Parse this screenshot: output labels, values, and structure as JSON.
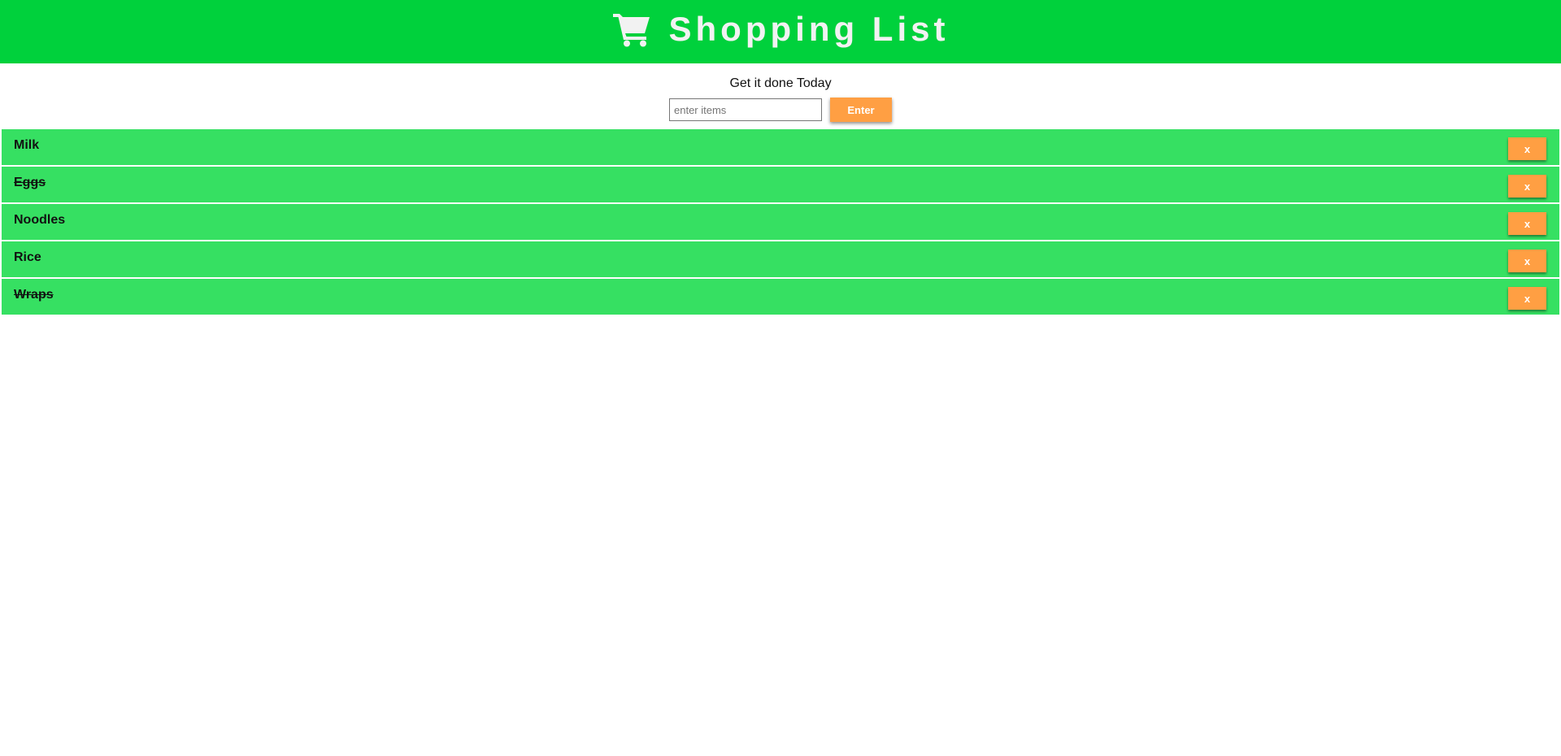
{
  "header": {
    "title": "Shopping List",
    "icon": "shopping-cart-icon",
    "background_color": "#00d13c"
  },
  "subtitle": "Get it done Today",
  "form": {
    "input_placeholder": "enter items",
    "input_value": "",
    "enter_label": "Enter"
  },
  "list": {
    "items": [
      {
        "label": "Milk",
        "done": false,
        "delete_label": "x"
      },
      {
        "label": "Eggs",
        "done": true,
        "delete_label": "x"
      },
      {
        "label": "Noodles",
        "done": false,
        "delete_label": "x"
      },
      {
        "label": "Rice",
        "done": false,
        "delete_label": "x"
      },
      {
        "label": "Wraps",
        "done": true,
        "delete_label": "x"
      }
    ]
  },
  "colors": {
    "item_background": "#36e062",
    "button": "#ff9f43"
  }
}
